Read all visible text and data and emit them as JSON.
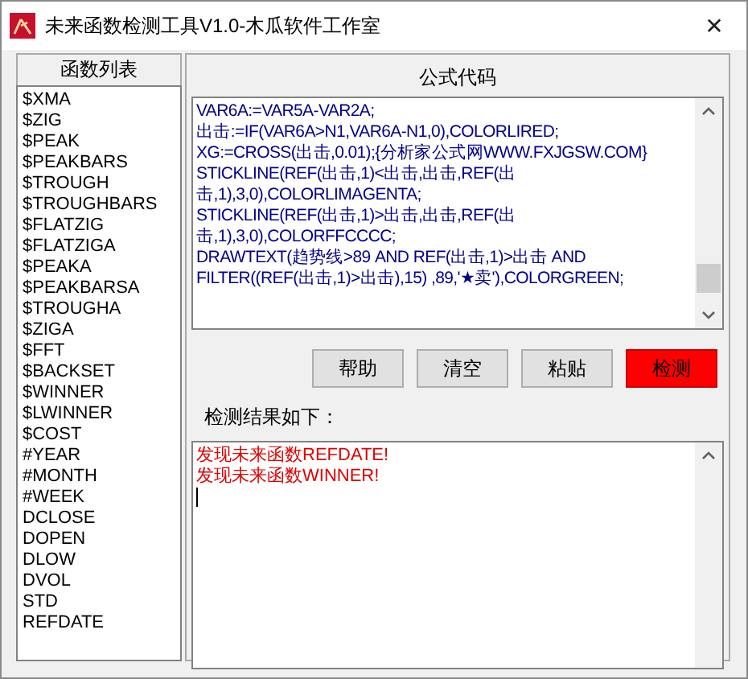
{
  "window": {
    "title": "未来函数检测工具V1.0-木瓜软件工作室",
    "close": "✕"
  },
  "function_list": {
    "header": "函数列表",
    "items": [
      "$XMA",
      "$ZIG",
      "$PEAK",
      "$PEAKBARS",
      "$TROUGH",
      "$TROUGHBARS",
      "$FLATZIG",
      "$FLATZIGA",
      "$PEAKA",
      "$PEAKBARSA",
      "$TROUGHA",
      "$ZIGA",
      "$FFT",
      "$BACKSET",
      "$WINNER",
      "$LWINNER",
      "$COST",
      "#YEAR",
      "#MONTH",
      "#WEEK",
      "DCLOSE",
      "DOPEN",
      "DLOW",
      "DVOL",
      "STD",
      "REFDATE"
    ]
  },
  "formula": {
    "header": "公式代码",
    "lines": [
      "VAR6A:=VAR5A-VAR2A;",
      "出击:=IF(VAR6A>N1,VAR6A-N1,0),COLORLIRED;",
      "XG:=CROSS(出击,0.01);{分析家公式网WWW.FXJGSW.COM}",
      "STICKLINE(REF(出击,1)<出击,出击,REF(出",
      "击,1),3,0),COLORLIMAGENTA;",
      "STICKLINE(REF(出击,1)>出击,出击,REF(出",
      "击,1),3,0),COLORFFCCCC;",
      "DRAWTEXT(趋势线>89 AND REF(出击,1)>出击 AND",
      "FILTER((REF(出击,1)>出击),15) ,89,'★卖'),COLORGREEN;"
    ]
  },
  "buttons": [
    {
      "label": "帮助",
      "highlighted": false
    },
    {
      "label": "清空",
      "highlighted": false
    },
    {
      "label": "粘贴",
      "highlighted": false
    },
    {
      "label": "检测",
      "highlighted": true
    }
  ],
  "results": {
    "label": "检测结果如下：",
    "lines": [
      "发现未来函数REFDATE!",
      "发现未来函数WINNER!"
    ]
  }
}
